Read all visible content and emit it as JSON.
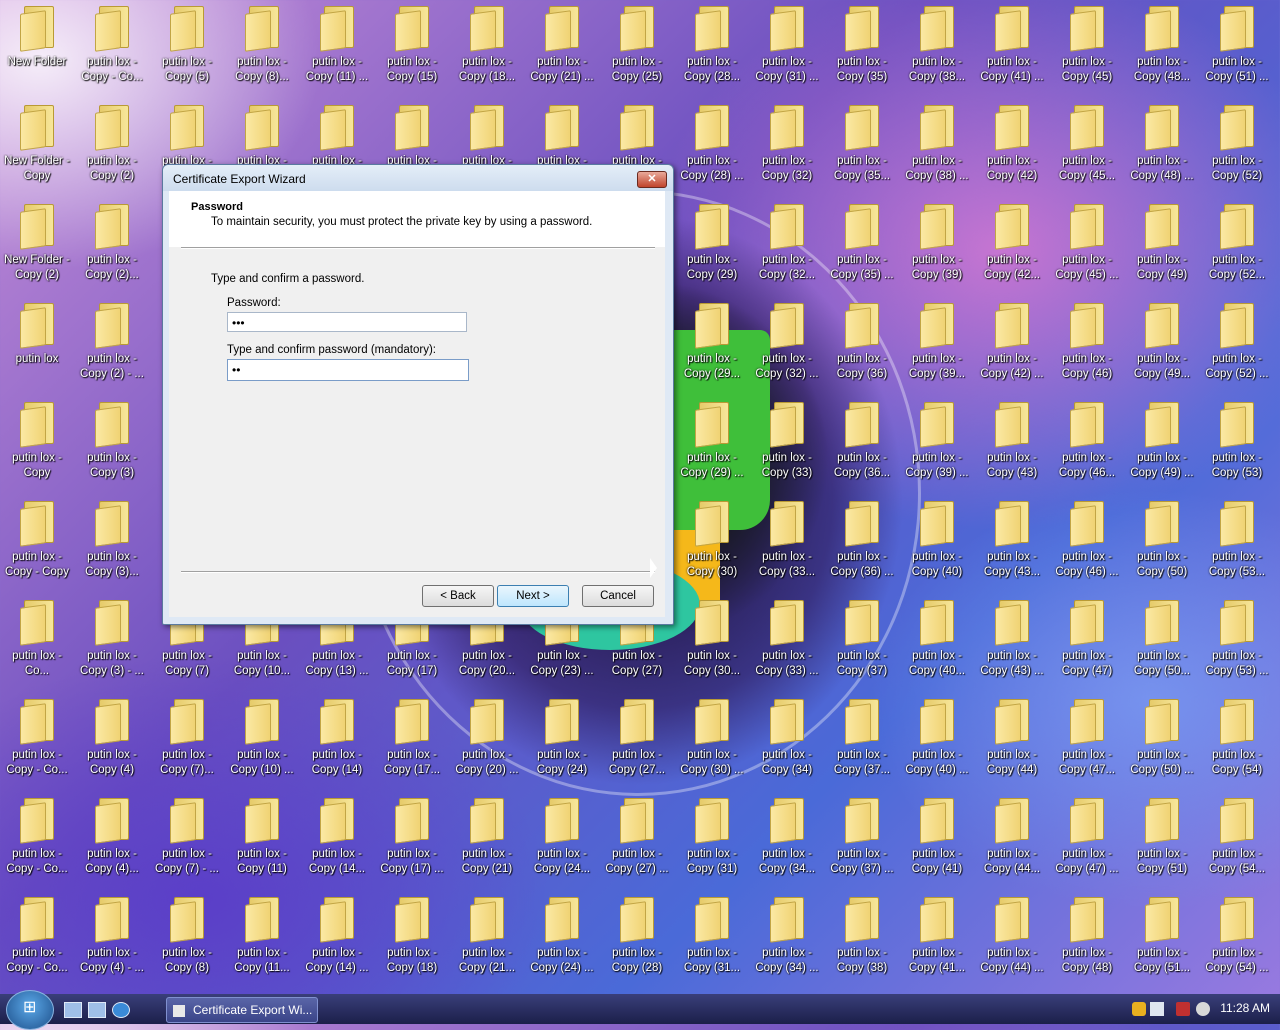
{
  "desktop": {
    "columns": [
      [
        "New Folder",
        "New Folder - Copy",
        "New Folder - Copy (2)",
        "putin lox",
        "putin lox - Copy",
        "putin lox - Copy - Copy",
        "putin lox - Co...",
        "putin lox - Copy - Co...",
        "putin lox - Copy - Co...",
        "putin lox - Copy - Co..."
      ],
      [
        "putin lox - Copy - Co...",
        "putin lox - Copy (2)",
        "putin lox - Copy (2)...",
        "putin lox - Copy (2) - ...",
        "putin lox - Copy (3)",
        "putin lox - Copy (3)...",
        "putin lox - Copy (3) - ...",
        "putin lox - Copy (4)",
        "putin lox - Copy (4)...",
        "putin lox - Copy (4) - ..."
      ],
      [
        "putin lox - Copy (5)",
        "putin lox -",
        "",
        "",
        "",
        "",
        "putin lox - Copy (7)",
        "putin lox - Copy (7)...",
        "putin lox - Copy (7) - ...",
        "putin lox - Copy (8)"
      ],
      [
        "putin lox - Copy (8)...",
        "putin lox -",
        "",
        "",
        "",
        "",
        "putin lox - Copy (10...",
        "putin lox - Copy (10) ...",
        "putin lox - Copy (11)",
        "putin lox - Copy (11..."
      ],
      [
        "putin lox - Copy (11) ...",
        "putin lox -",
        "",
        "",
        "",
        "",
        "putin lox - Copy (13) ...",
        "putin lox - Copy (14)",
        "putin lox - Copy (14...",
        "putin lox - Copy (14) ..."
      ],
      [
        "putin lox - Copy (15)",
        "putin lox -",
        "",
        "",
        "",
        "",
        "putin lox - Copy (17)",
        "putin lox - Copy (17...",
        "putin lox - Copy (17) ...",
        "putin lox - Copy (18)"
      ],
      [
        "putin lox - Copy (18...",
        "putin lox -",
        "",
        "",
        "",
        "",
        "putin lox - Copy (20...",
        "putin lox - Copy (20) ...",
        "putin lox - Copy (21)",
        "putin lox - Copy (21..."
      ],
      [
        "putin lox - Copy (21) ...",
        "putin lox -",
        "",
        "",
        "",
        "",
        "putin lox - Copy (23) ...",
        "putin lox - Copy (24)",
        "putin lox - Copy (24...",
        "putin lox - Copy (24) ..."
      ],
      [
        "putin lox - Copy (25)",
        "putin lox -",
        "",
        "",
        "",
        "",
        "putin lox - Copy (27)",
        "putin lox - Copy (27...",
        "putin lox - Copy (27) ...",
        "putin lox - Copy (28)"
      ],
      [
        "putin lox - Copy (28...",
        "putin lox - Copy (28) ...",
        "putin lox - Copy (29)",
        "putin lox - Copy (29...",
        "putin lox - Copy (29) ...",
        "putin lox - Copy (30)",
        "putin lox - Copy (30...",
        "putin lox - Copy (30) ...",
        "putin lox - Copy (31)",
        "putin lox - Copy (31..."
      ],
      [
        "putin lox - Copy (31) ...",
        "putin lox - Copy (32)",
        "putin lox - Copy (32...",
        "putin lox - Copy (32) ...",
        "putin lox - Copy (33)",
        "putin lox - Copy (33...",
        "putin lox - Copy (33) ...",
        "putin lox - Copy (34)",
        "putin lox - Copy (34...",
        "putin lox - Copy (34) ..."
      ],
      [
        "putin lox - Copy (35)",
        "putin lox - Copy (35...",
        "putin lox - Copy (35) ...",
        "putin lox - Copy (36)",
        "putin lox - Copy (36...",
        "putin lox - Copy (36) ...",
        "putin lox - Copy (37)",
        "putin lox - Copy (37...",
        "putin lox - Copy (37) ...",
        "putin lox - Copy (38)"
      ],
      [
        "putin lox - Copy (38...",
        "putin lox - Copy (38) ...",
        "putin lox - Copy (39)",
        "putin lox - Copy (39...",
        "putin lox - Copy (39) ...",
        "putin lox - Copy (40)",
        "putin lox - Copy (40...",
        "putin lox - Copy (40) ...",
        "putin lox - Copy (41)",
        "putin lox - Copy (41..."
      ],
      [
        "putin lox - Copy (41) ...",
        "putin lox - Copy (42)",
        "putin lox - Copy (42...",
        "putin lox - Copy (42) ...",
        "putin lox - Copy (43)",
        "putin lox - Copy (43...",
        "putin lox - Copy (43) ...",
        "putin lox - Copy (44)",
        "putin lox - Copy (44...",
        "putin lox - Copy (44) ..."
      ],
      [
        "putin lox - Copy (45)",
        "putin lox - Copy (45...",
        "putin lox - Copy (45) ...",
        "putin lox - Copy (46)",
        "putin lox - Copy (46...",
        "putin lox - Copy (46) ...",
        "putin lox - Copy (47)",
        "putin lox - Copy (47...",
        "putin lox - Copy (47) ...",
        "putin lox - Copy (48)"
      ],
      [
        "putin lox - Copy (48...",
        "putin lox - Copy (48) ...",
        "putin lox - Copy (49)",
        "putin lox - Copy (49...",
        "putin lox - Copy (49) ...",
        "putin lox - Copy (50)",
        "putin lox - Copy (50...",
        "putin lox - Copy (50) ...",
        "putin lox - Copy (51)",
        "putin lox - Copy (51..."
      ],
      [
        "putin lox - Copy (51) ...",
        "putin lox - Copy (52)",
        "putin lox - Copy (52...",
        "putin lox - Copy (52) ...",
        "putin lox - Copy (53)",
        "putin lox - Copy (53...",
        "putin lox - Copy (53) ...",
        "putin lox - Copy (54)",
        "putin lox - Copy (54...",
        "putin lox - Copy (54) ..."
      ]
    ]
  },
  "dialog": {
    "title": "Certificate Export Wizard",
    "close_glyph": "✕",
    "header_title": "Password",
    "header_subtitle": "To maintain security, you must protect the private key by using a password.",
    "instruction": "Type and confirm a password.",
    "password_label": "Password:",
    "password_value": "•••",
    "confirm_label": "Type and confirm password (mandatory):",
    "confirm_value": "••",
    "back_label": "< Back",
    "next_label": "Next >",
    "cancel_label": "Cancel"
  },
  "taskbar": {
    "task_label": "Certificate Export Wi...",
    "clock": "11:28 AM"
  }
}
